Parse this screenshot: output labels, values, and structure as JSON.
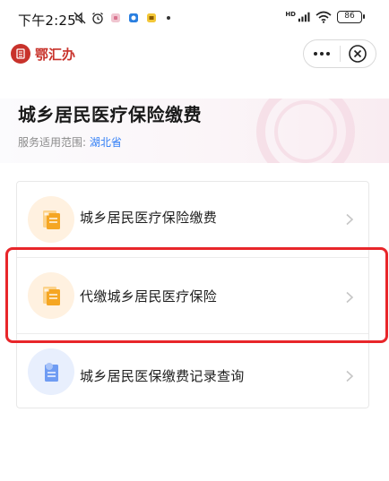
{
  "status_bar": {
    "time": "下午2:25",
    "network": "HD",
    "battery": "86"
  },
  "header": {
    "brand_name": "鄂汇办"
  },
  "hero": {
    "title": "城乡居民医疗保险缴费",
    "scope_label": "服务适用范围:",
    "scope_region": "湖北省"
  },
  "services": [
    {
      "label": "城乡居民医疗保险缴费",
      "icon": "document-card-icon",
      "icon_color": "#f5a623"
    },
    {
      "label": "代缴城乡居民医疗保险",
      "icon": "document-card-icon",
      "icon_color": "#f5a623"
    },
    {
      "label": "城乡居民医保缴费记录查询",
      "icon": "record-search-icon",
      "icon_color": "#6f9cf3"
    }
  ],
  "colors": {
    "brand": "#c8322b",
    "region_link": "#2f7df6",
    "highlight": "#e8262a"
  }
}
